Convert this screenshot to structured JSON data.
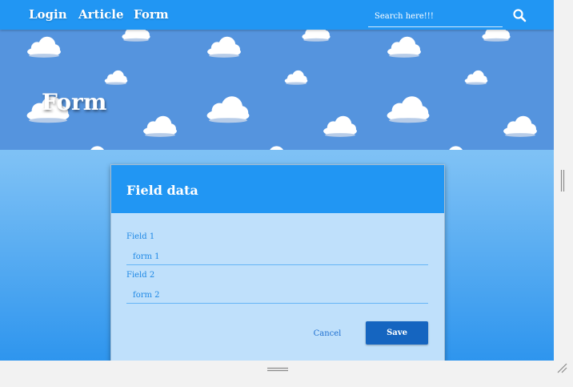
{
  "nav": {
    "links": [
      "Login",
      "Article",
      "Form"
    ],
    "search_placeholder": "Search here!!!"
  },
  "hero": {
    "title": "Form"
  },
  "card": {
    "title": "Field data",
    "fields": [
      {
        "label": "Field 1",
        "value": "form 1"
      },
      {
        "label": "Field 2",
        "value": "form 2"
      }
    ],
    "cancel_label": "Cancel",
    "save_label": "Save"
  },
  "icons": {
    "search": "search-icon",
    "cloud": "cloud-icon",
    "scroll_handle": "scroll-handle-icon",
    "resize_grip": "resize-grip-icon"
  },
  "colors": {
    "primary": "#2196f3",
    "hero_bg": "#5594de",
    "card_bg": "#bfe0fb",
    "save_button": "#1565c0",
    "field_text": "#1e88e5"
  }
}
